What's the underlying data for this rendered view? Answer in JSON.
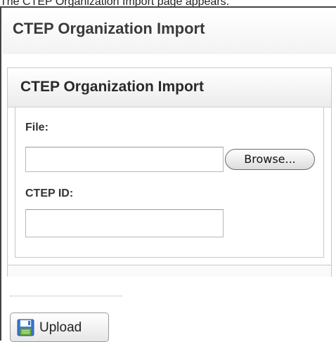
{
  "caption": "The CTEP Organization Import page appears.",
  "page": {
    "title": "CTEP Organization Import"
  },
  "form": {
    "title": "CTEP Organization Import",
    "file_label": "File:",
    "file_value": "",
    "browse_label": "Browse...",
    "ctep_id_label": "CTEP ID:",
    "ctep_id_value": ""
  },
  "actions": {
    "upload_label": "Upload",
    "upload_icon": "save-disk-icon"
  },
  "colors": {
    "icon_blue": "#3b74c9",
    "icon_green": "#6fb43a"
  }
}
